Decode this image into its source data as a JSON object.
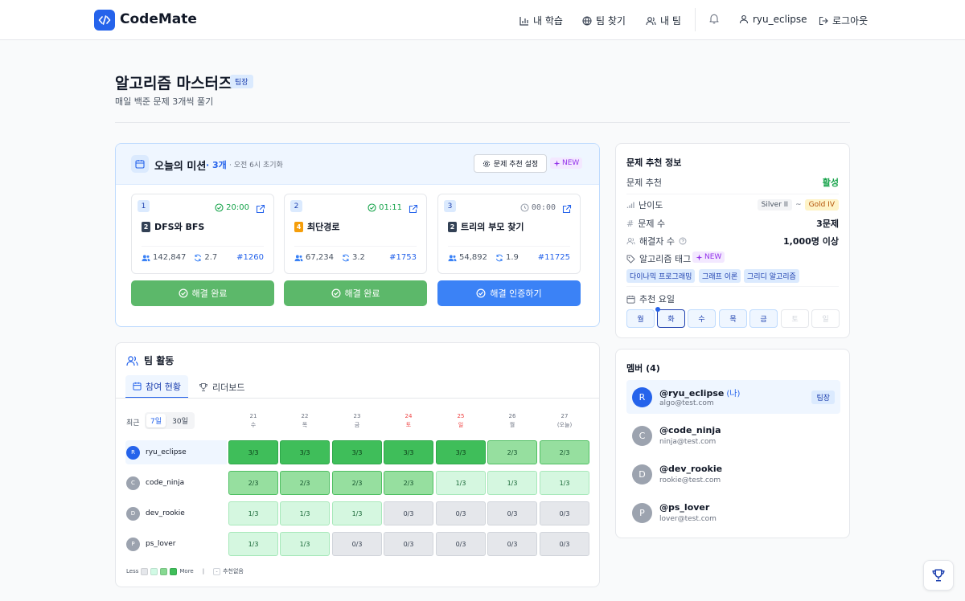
{
  "app": {
    "name": "CodeMate"
  },
  "nav": {
    "my_study": "내 학습",
    "find_team": "팀 찾기",
    "my_team": "내 팀",
    "username": "ryu_eclipse",
    "logout": "로그아웃"
  },
  "team": {
    "name": "알고리즘 마스터즈",
    "role_badge": "팀장",
    "description": "매일 백준 문제 3개씩 풀기"
  },
  "mission": {
    "title": "오늘의 미션",
    "count": "· 3개",
    "reset": "· 오전 6시 초기화",
    "settings_button": "문제 추천 설정",
    "new_badge": "NEW",
    "problems": [
      {
        "num": "1",
        "time": "20:00",
        "status": "done",
        "tier": "2",
        "tier_color": "#334155",
        "name": "DFS와 BFS",
        "solvers": "142,847",
        "level": "2.7",
        "id": "#1260",
        "button": "해결 완료"
      },
      {
        "num": "2",
        "time": "01:11",
        "status": "done",
        "tier": "4",
        "tier_color": "#f59e0b",
        "name": "최단경로",
        "solvers": "67,234",
        "level": "3.2",
        "id": "#1753",
        "button": "해결 완료"
      },
      {
        "num": "3",
        "time": "00:00",
        "status": "pending",
        "tier": "2",
        "tier_color": "#334155",
        "name": "트리의 부모 찾기",
        "solvers": "54,892",
        "level": "1.9",
        "id": "#11725",
        "button": "해결 인증하기"
      }
    ]
  },
  "activity": {
    "title": "팀 활동",
    "tabs": [
      "참여 현황",
      "리더보드"
    ],
    "range_label": "최근",
    "range_options": [
      "7일",
      "30일"
    ],
    "days": [
      {
        "date": "21",
        "dow": "수",
        "color": "#6b7280"
      },
      {
        "date": "22",
        "dow": "목",
        "color": "#6b7280"
      },
      {
        "date": "23",
        "dow": "금",
        "color": "#6b7280"
      },
      {
        "date": "24",
        "dow": "토",
        "color": "#ef4444"
      },
      {
        "date": "25",
        "dow": "일",
        "color": "#ef4444"
      },
      {
        "date": "26",
        "dow": "월",
        "color": "#6b7280"
      },
      {
        "date": "27",
        "dow": "(오늘)",
        "color": "#6b7280"
      }
    ],
    "members": [
      {
        "name": "ryu_eclipse",
        "initial": "R",
        "color": "#2563eb",
        "highlight": true,
        "cells": [
          "3/3",
          "3/3",
          "3/3",
          "3/3",
          "3/3",
          "2/3",
          "2/3"
        ]
      },
      {
        "name": "code_ninja",
        "initial": "C",
        "color": "#9ca3af",
        "highlight": false,
        "cells": [
          "2/3",
          "2/3",
          "2/3",
          "2/3",
          "1/3",
          "1/3",
          "1/3"
        ]
      },
      {
        "name": "dev_rookie",
        "initial": "D",
        "color": "#9ca3af",
        "highlight": false,
        "cells": [
          "1/3",
          "1/3",
          "1/3",
          "0/3",
          "0/3",
          "0/3",
          "0/3"
        ]
      },
      {
        "name": "ps_lover",
        "initial": "P",
        "color": "#9ca3af",
        "highlight": false,
        "cells": [
          "1/3",
          "1/3",
          "0/3",
          "0/3",
          "0/3",
          "0/3",
          "0/3"
        ]
      }
    ],
    "legend_less": "Less",
    "legend_more": "More",
    "legend_sep": "|",
    "legend_none_symbol": "-",
    "legend_none": "추천없음"
  },
  "recommend": {
    "title": "문제 추천 정보",
    "status_label": "문제 추천",
    "status_value": "활성",
    "difficulty_label": "난이도",
    "difficulty_from": "Silver II",
    "difficulty_sep": "~",
    "difficulty_to": "Gold IV",
    "count_label": "문제 수",
    "count_value": "3문제",
    "solvers_label": "해결자 수",
    "solvers_value": "1,000명 이상",
    "tags_label": "알고리즘 태그",
    "new_badge": "NEW",
    "tags": [
      "다이나믹 프로그래밍",
      "그래프 이론",
      "그리디 알고리즘"
    ],
    "days_label": "추천 요일",
    "days": [
      {
        "label": "월",
        "state": "on"
      },
      {
        "label": "화",
        "state": "today"
      },
      {
        "label": "수",
        "state": "on"
      },
      {
        "label": "목",
        "state": "on"
      },
      {
        "label": "금",
        "state": "on"
      },
      {
        "label": "토",
        "state": "off"
      },
      {
        "label": "일",
        "state": "off"
      }
    ]
  },
  "members": {
    "title": "멤버 (4)",
    "me_label": "(나)",
    "leader_badge": "팀장",
    "list": [
      {
        "handle": "@ryu_eclipse",
        "email": "algo@test.com",
        "initial": "R",
        "color": "#2563eb",
        "me": true,
        "leader": true
      },
      {
        "handle": "@code_ninja",
        "email": "ninja@test.com",
        "initial": "C",
        "color": "#9ca3af",
        "me": false,
        "leader": false
      },
      {
        "handle": "@dev_rookie",
        "email": "rookie@test.com",
        "initial": "D",
        "color": "#9ca3af",
        "me": false,
        "leader": false
      },
      {
        "handle": "@ps_lover",
        "email": "lover@test.com",
        "initial": "P",
        "color": "#9ca3af",
        "me": false,
        "leader": false
      }
    ]
  },
  "colors": {
    "primary": "#2563eb",
    "success": "#5cb86a",
    "active_green": "#16a34a"
  }
}
